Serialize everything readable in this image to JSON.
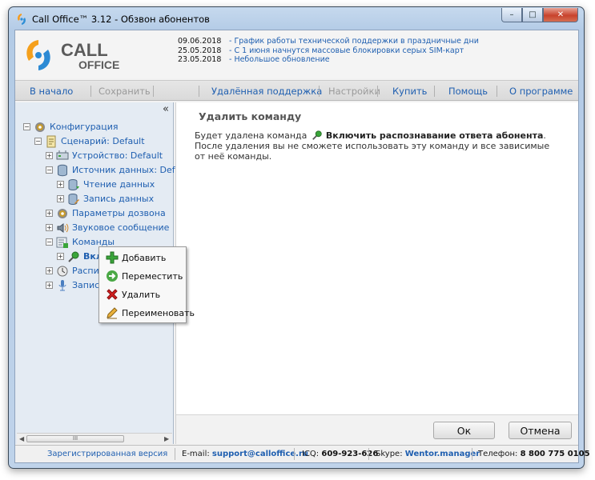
{
  "window": {
    "title": "Call Office™ 3.12 - Обзвон абонентов"
  },
  "window_controls": {
    "minimize": "–",
    "maximize": "□",
    "close": "✕"
  },
  "logo": {
    "line1": "CALL",
    "line2": "OFFICE"
  },
  "news": [
    {
      "date": "09.06.2018",
      "text": "- График работы технической поддержки в праздничные дни"
    },
    {
      "date": "25.05.2018",
      "text": "- С 1 июня начнутся массовые блокировки серых SIM-карт"
    },
    {
      "date": "23.05.2018",
      "text": "- Небольшое обновление"
    }
  ],
  "toolbar": {
    "home": "В начало",
    "save": "Сохранить",
    "remote_support": "Удалённая поддержка",
    "settings": "Настройки",
    "buy": "Купить",
    "help": "Помощь",
    "about": "О программе"
  },
  "tree": {
    "collapse": "«",
    "items": [
      {
        "label": "Конфигурация",
        "icon": "gear-icon"
      },
      {
        "label": "Сценарий: Default",
        "icon": "script-icon"
      },
      {
        "label": "Устройство: Default",
        "icon": "device-icon"
      },
      {
        "label": "Источник данных: Default",
        "icon": "database-icon"
      },
      {
        "label": "Чтение данных",
        "icon": "database-read-icon"
      },
      {
        "label": "Запись данных",
        "icon": "database-write-icon"
      },
      {
        "label": "Параметры дозвона",
        "icon": "gear-icon"
      },
      {
        "label": "Звуковое сообщение",
        "icon": "speaker-icon"
      },
      {
        "label": "Команды",
        "icon": "commands-icon"
      },
      {
        "label": "Включ",
        "icon": "microphone-command-icon"
      },
      {
        "label": "Расписа",
        "icon": "clock-icon"
      },
      {
        "label": "Запись р",
        "icon": "microphone-icon"
      }
    ],
    "scroll_thumb": "III"
  },
  "context_menu": {
    "items": [
      {
        "label": "Добавить",
        "icon": "add-icon"
      },
      {
        "label": "Переместить",
        "icon": "move-icon"
      },
      {
        "label": "Удалить",
        "icon": "delete-icon"
      },
      {
        "label": "Переименовать",
        "icon": "rename-icon"
      }
    ]
  },
  "main": {
    "title": "Удалить команду",
    "text_before": "Будет удалена команда",
    "command_name": "Включить распознавание ответа абонента",
    "text_after": ". После удаления вы не сможете использовать эту команду и все зависимые от неё команды."
  },
  "buttons": {
    "ok": "Ок",
    "cancel": "Отмена"
  },
  "status": {
    "registered": "Зарегистрированная версия",
    "email_label": "E-mail:",
    "email": "support@calloffice.ru",
    "icq_label": "ICQ:",
    "icq": "609-923-626",
    "skype_label": "Skype:",
    "skype": "Wentor.manager",
    "phone_label": "Телефон:",
    "phone": "8 800 775 0105"
  },
  "colors": {
    "link": "#1f5fb0",
    "close": "#c8422c",
    "add": "#3aa53a",
    "delete": "#d42020"
  }
}
